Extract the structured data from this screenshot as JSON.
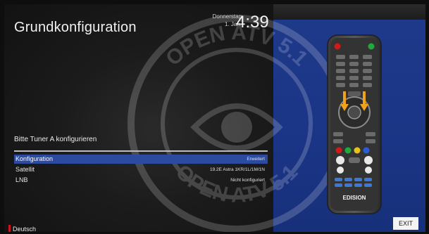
{
  "header": {
    "title": "Grundkonfiguration",
    "weekday": "Donnerstag",
    "date": "1. Jan.",
    "time": "4:39"
  },
  "main": {
    "prompt": "Bitte Tuner A konfigurieren",
    "rows": [
      {
        "label": "Konfiguration",
        "value": "Erweitert"
      },
      {
        "label": "Satellit",
        "value": "19.2E Astra 1KR/1L/1M/1N"
      },
      {
        "label": "LNB",
        "value": "Nicht konfiguriert"
      }
    ]
  },
  "footer": {
    "language": "Deutsch",
    "exit_label": "EXIT"
  },
  "watermark": {
    "text": "OPEN ATV 5.1"
  },
  "remote": {
    "brand": "EDISION"
  },
  "colors": {
    "selection": "#2c4aa0",
    "right_panel": "#1f3a8a",
    "red_indicator": "#c9151b"
  }
}
